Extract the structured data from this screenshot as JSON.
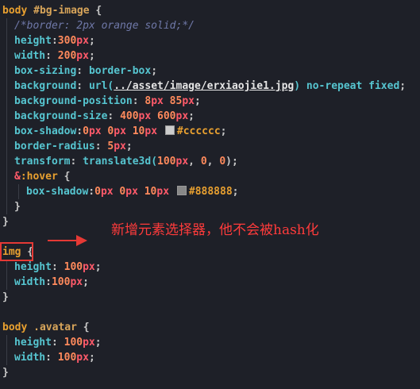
{
  "colors": {
    "background": "#1e2028",
    "selector": "#e8a030",
    "hash_id": "#d8a55a",
    "class": "#d8a55a",
    "brace": "#c8c8c8",
    "property": "#56c5d0",
    "number": "#ff8a5c",
    "unit": "#ff5a6a",
    "value_keyword": "#56c5d0",
    "comment": "#6f78a8",
    "url_fn": "#56c5d0",
    "url_string": "#e6e6e6",
    "ampersand": "#ff5a6a",
    "hex": "#e8a030",
    "annotation": "#ff3b3b",
    "box": "#e53935"
  },
  "code_lines": [
    {
      "indent": 0,
      "tokens": [
        {
          "t": "body ",
          "c": "selector"
        },
        {
          "t": "#bg-image",
          "c": "hash_id"
        },
        {
          "t": " {",
          "c": "brace"
        }
      ]
    },
    {
      "indent": 1,
      "tokens": [
        {
          "t": "/*border: 2px orange solid;*/",
          "c": "comment",
          "i": true
        }
      ]
    },
    {
      "indent": 1,
      "tokens": [
        {
          "t": "height",
          "c": "property"
        },
        {
          "t": ":",
          "c": "brace"
        },
        {
          "t": "300",
          "c": "number"
        },
        {
          "t": "px",
          "c": "unit"
        },
        {
          "t": ";",
          "c": "brace"
        }
      ]
    },
    {
      "indent": 1,
      "tokens": [
        {
          "t": "width",
          "c": "property"
        },
        {
          "t": ": ",
          "c": "brace"
        },
        {
          "t": "200",
          "c": "number"
        },
        {
          "t": "px",
          "c": "unit"
        },
        {
          "t": ";",
          "c": "brace"
        }
      ]
    },
    {
      "indent": 1,
      "tokens": [
        {
          "t": "box-sizing",
          "c": "property"
        },
        {
          "t": ": ",
          "c": "brace"
        },
        {
          "t": "border-box",
          "c": "value_keyword"
        },
        {
          "t": ";",
          "c": "brace"
        }
      ]
    },
    {
      "indent": 1,
      "tokens": [
        {
          "t": "background",
          "c": "property"
        },
        {
          "t": ": ",
          "c": "brace"
        },
        {
          "t": "url(",
          "c": "url_fn"
        },
        {
          "t": "../asset/image/erxiaojie1.jpg",
          "c": "url_string",
          "u": true
        },
        {
          "t": ")",
          "c": "url_fn"
        },
        {
          "t": " no-repeat fixed",
          "c": "value_keyword"
        },
        {
          "t": ";",
          "c": "brace"
        }
      ]
    },
    {
      "indent": 1,
      "tokens": [
        {
          "t": "background-position",
          "c": "property"
        },
        {
          "t": ": ",
          "c": "brace"
        },
        {
          "t": "8",
          "c": "number"
        },
        {
          "t": "px",
          "c": "unit"
        },
        {
          "t": " 85",
          "c": "number"
        },
        {
          "t": "px",
          "c": "unit"
        },
        {
          "t": ";",
          "c": "brace"
        }
      ]
    },
    {
      "indent": 1,
      "tokens": [
        {
          "t": "background-size",
          "c": "property"
        },
        {
          "t": ": ",
          "c": "brace"
        },
        {
          "t": "400",
          "c": "number"
        },
        {
          "t": "px",
          "c": "unit"
        },
        {
          "t": " 600",
          "c": "number"
        },
        {
          "t": "px",
          "c": "unit"
        },
        {
          "t": ";",
          "c": "brace"
        }
      ]
    },
    {
      "indent": 1,
      "tokens": [
        {
          "t": "box-shadow",
          "c": "property"
        },
        {
          "t": ":",
          "c": "brace"
        },
        {
          "t": "0",
          "c": "number"
        },
        {
          "t": "px",
          "c": "unit"
        },
        {
          "t": " 0",
          "c": "number"
        },
        {
          "t": "px",
          "c": "unit"
        },
        {
          "t": " 10",
          "c": "number"
        },
        {
          "t": "px",
          "c": "unit"
        },
        {
          "t": " ",
          "c": "brace"
        },
        {
          "swatch": "#cccccc"
        },
        {
          "t": "#cccccc",
          "c": "hex"
        },
        {
          "t": ";",
          "c": "brace"
        }
      ]
    },
    {
      "indent": 1,
      "tokens": [
        {
          "t": "border-radius",
          "c": "property"
        },
        {
          "t": ": ",
          "c": "brace"
        },
        {
          "t": "5",
          "c": "number"
        },
        {
          "t": "px",
          "c": "unit"
        },
        {
          "t": ";",
          "c": "brace"
        }
      ]
    },
    {
      "indent": 1,
      "tokens": [
        {
          "t": "transform",
          "c": "property"
        },
        {
          "t": ": ",
          "c": "brace"
        },
        {
          "t": "translate3d(",
          "c": "url_fn"
        },
        {
          "t": "100",
          "c": "number"
        },
        {
          "t": "px",
          "c": "unit"
        },
        {
          "t": ", ",
          "c": "brace"
        },
        {
          "t": "0",
          "c": "number"
        },
        {
          "t": ", ",
          "c": "brace"
        },
        {
          "t": "0",
          "c": "number"
        },
        {
          "t": ");",
          "c": "brace"
        }
      ]
    },
    {
      "indent": 1,
      "tokens": [
        {
          "t": "&",
          "c": "ampersand"
        },
        {
          "t": ":hover",
          "c": "selector"
        },
        {
          "t": " {",
          "c": "brace"
        }
      ]
    },
    {
      "indent": 2,
      "tokens": [
        {
          "t": "box-shadow",
          "c": "property"
        },
        {
          "t": ":",
          "c": "brace"
        },
        {
          "t": "0",
          "c": "number"
        },
        {
          "t": "px",
          "c": "unit"
        },
        {
          "t": " 0",
          "c": "number"
        },
        {
          "t": "px",
          "c": "unit"
        },
        {
          "t": " 10",
          "c": "number"
        },
        {
          "t": "px",
          "c": "unit"
        },
        {
          "t": " ",
          "c": "brace"
        },
        {
          "swatch": "#888888"
        },
        {
          "t": "#888888",
          "c": "hex"
        },
        {
          "t": ";",
          "c": "brace"
        }
      ]
    },
    {
      "indent": 1,
      "tokens": [
        {
          "t": "}",
          "c": "brace"
        }
      ]
    },
    {
      "indent": 0,
      "tokens": [
        {
          "t": "}",
          "c": "brace"
        }
      ]
    },
    {
      "indent": 0,
      "tokens": []
    },
    {
      "indent": 0,
      "tokens": [
        {
          "t": "img",
          "c": "selector"
        },
        {
          "t": " {",
          "c": "brace"
        }
      ]
    },
    {
      "indent": 1,
      "tokens": [
        {
          "t": "height",
          "c": "property"
        },
        {
          "t": ": ",
          "c": "brace"
        },
        {
          "t": "100",
          "c": "number"
        },
        {
          "t": "px",
          "c": "unit"
        },
        {
          "t": ";",
          "c": "brace"
        }
      ]
    },
    {
      "indent": 1,
      "tokens": [
        {
          "t": "width",
          "c": "property"
        },
        {
          "t": ":",
          "c": "brace"
        },
        {
          "t": "100",
          "c": "number"
        },
        {
          "t": "px",
          "c": "unit"
        },
        {
          "t": ";",
          "c": "brace"
        }
      ]
    },
    {
      "indent": 0,
      "tokens": [
        {
          "t": "}",
          "c": "brace"
        }
      ]
    },
    {
      "indent": 0,
      "tokens": []
    },
    {
      "indent": 0,
      "tokens": [
        {
          "t": "body ",
          "c": "selector"
        },
        {
          "t": ".avatar",
          "c": "class"
        },
        {
          "t": " {",
          "c": "brace"
        }
      ]
    },
    {
      "indent": 1,
      "tokens": [
        {
          "t": "height",
          "c": "property"
        },
        {
          "t": ": ",
          "c": "brace"
        },
        {
          "t": "100",
          "c": "number"
        },
        {
          "t": "px",
          "c": "unit"
        },
        {
          "t": ";",
          "c": "brace"
        }
      ]
    },
    {
      "indent": 1,
      "tokens": [
        {
          "t": "width",
          "c": "property"
        },
        {
          "t": ": ",
          "c": "brace"
        },
        {
          "t": "100",
          "c": "number"
        },
        {
          "t": "px",
          "c": "unit"
        },
        {
          "t": ";",
          "c": "brace"
        }
      ]
    },
    {
      "indent": 0,
      "tokens": [
        {
          "t": "}",
          "c": "brace"
        }
      ]
    }
  ],
  "annotation": {
    "text": "新增元素选择器，他不会被hash化"
  }
}
